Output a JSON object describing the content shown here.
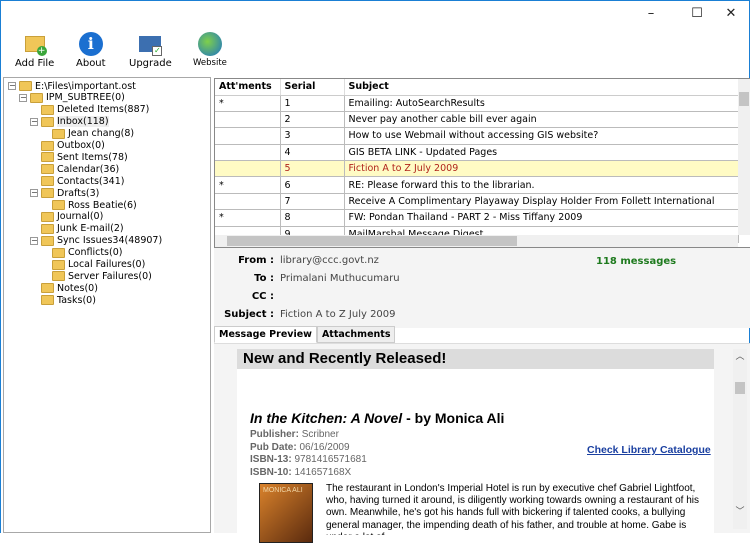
{
  "window": {
    "minimize": "–",
    "maximize": "☐",
    "close": "✕"
  },
  "toolbar": [
    {
      "label": "Add File",
      "icon": "add-file-icon"
    },
    {
      "label": "About",
      "icon": "info-icon"
    },
    {
      "label": "Upgrade",
      "icon": "upgrade-icon"
    },
    {
      "label": "Website",
      "icon": "globe-icon"
    }
  ],
  "tree": [
    {
      "label": "E:\\Files\\important.ost",
      "level": 0,
      "expander": "−"
    },
    {
      "label": "IPM_SUBTREE(0)",
      "level": 1,
      "expander": "−"
    },
    {
      "label": "Deleted Items(887)",
      "level": 2
    },
    {
      "label": "Inbox(118)",
      "level": 2,
      "expander": "−",
      "selected": true
    },
    {
      "label": "Jean chang(8)",
      "level": 3
    },
    {
      "label": "Outbox(0)",
      "level": 2
    },
    {
      "label": "Sent Items(78)",
      "level": 2
    },
    {
      "label": "Calendar(36)",
      "level": 2
    },
    {
      "label": "Contacts(341)",
      "level": 2
    },
    {
      "label": "Drafts(3)",
      "level": 2,
      "expander": "−"
    },
    {
      "label": "Ross Beatie(6)",
      "level": 3
    },
    {
      "label": "Journal(0)",
      "level": 2
    },
    {
      "label": "Junk E-mail(2)",
      "level": 2
    },
    {
      "label": "Sync Issues34(48907)",
      "level": 2,
      "expander": "−"
    },
    {
      "label": "Conflicts(0)",
      "level": 3
    },
    {
      "label": "Local Failures(0)",
      "level": 3
    },
    {
      "label": "Server Failures(0)",
      "level": 3
    },
    {
      "label": "Notes(0)",
      "level": 2
    },
    {
      "label": "Tasks(0)",
      "level": 2
    }
  ],
  "grid": {
    "columns": [
      "Att'ments",
      "Serial",
      "Subject"
    ],
    "rows": [
      [
        "*",
        "1",
        "Emailing: AutoSearchResults"
      ],
      [
        "",
        "2",
        "Never pay another cable bill ever again"
      ],
      [
        "",
        "3",
        "How to use Webmail without accessing GIS website?"
      ],
      [
        "",
        "4",
        "GIS BETA LINK - Updated Pages"
      ],
      [
        "",
        "5",
        "Fiction A to Z July 2009"
      ],
      [
        "*",
        "6",
        "RE: Please forward this to the librarian."
      ],
      [
        "",
        "7",
        "Receive A Complimentary Playaway Display Holder From Follett International"
      ],
      [
        "*",
        "8",
        "FW: Pondan Thailand - PART 2 - Miss Tiffany 2009"
      ],
      [
        "",
        "9",
        "MailMarshal Message Digest"
      ]
    ],
    "selected_serial": "5"
  },
  "header": {
    "from_label": "From :",
    "from": "library@ccc.govt.nz",
    "to_label": "To :",
    "to": "Primalani Muthucumaru",
    "cc_label": "CC :",
    "cc": "",
    "subject_label": "Subject :",
    "subject": "Fiction A to Z July 2009",
    "count": "118 messages"
  },
  "tabs": [
    "Message Preview",
    "Attachments"
  ],
  "preview": {
    "banner": "New and Recently Released!",
    "book_title": "In the Kitchen: A Novel",
    "book_by": " - by Monica Ali",
    "publisher_label": "Publisher:",
    "publisher": "Scribner",
    "pubdate_label": "Pub Date:",
    "pubdate": "06/16/2009",
    "isbn13_label": "ISBN-13:",
    "isbn13": "9781416571681",
    "isbn10_label": "ISBN-10:",
    "isbn10": "141657168X",
    "link": "Check Library Catalogue",
    "cover_text": "MONICA ALI",
    "body": "The restaurant in London's Imperial Hotel is run by executive chef Gabriel Lightfoot, who, having turned it around, is diligently working towards owning a restaurant of his own. Meanwhile, he's got his hands full with bickering if talented cooks, a bullying general manager, the impending death of his father, and trouble at home. Gabe is under a lot of"
  },
  "colors": {
    "accent": "#1a7fd4",
    "selected_row": "#fffbc4",
    "selected_text": "#b0241c",
    "count": "#1e7a1e",
    "link": "#1a3fa0"
  }
}
